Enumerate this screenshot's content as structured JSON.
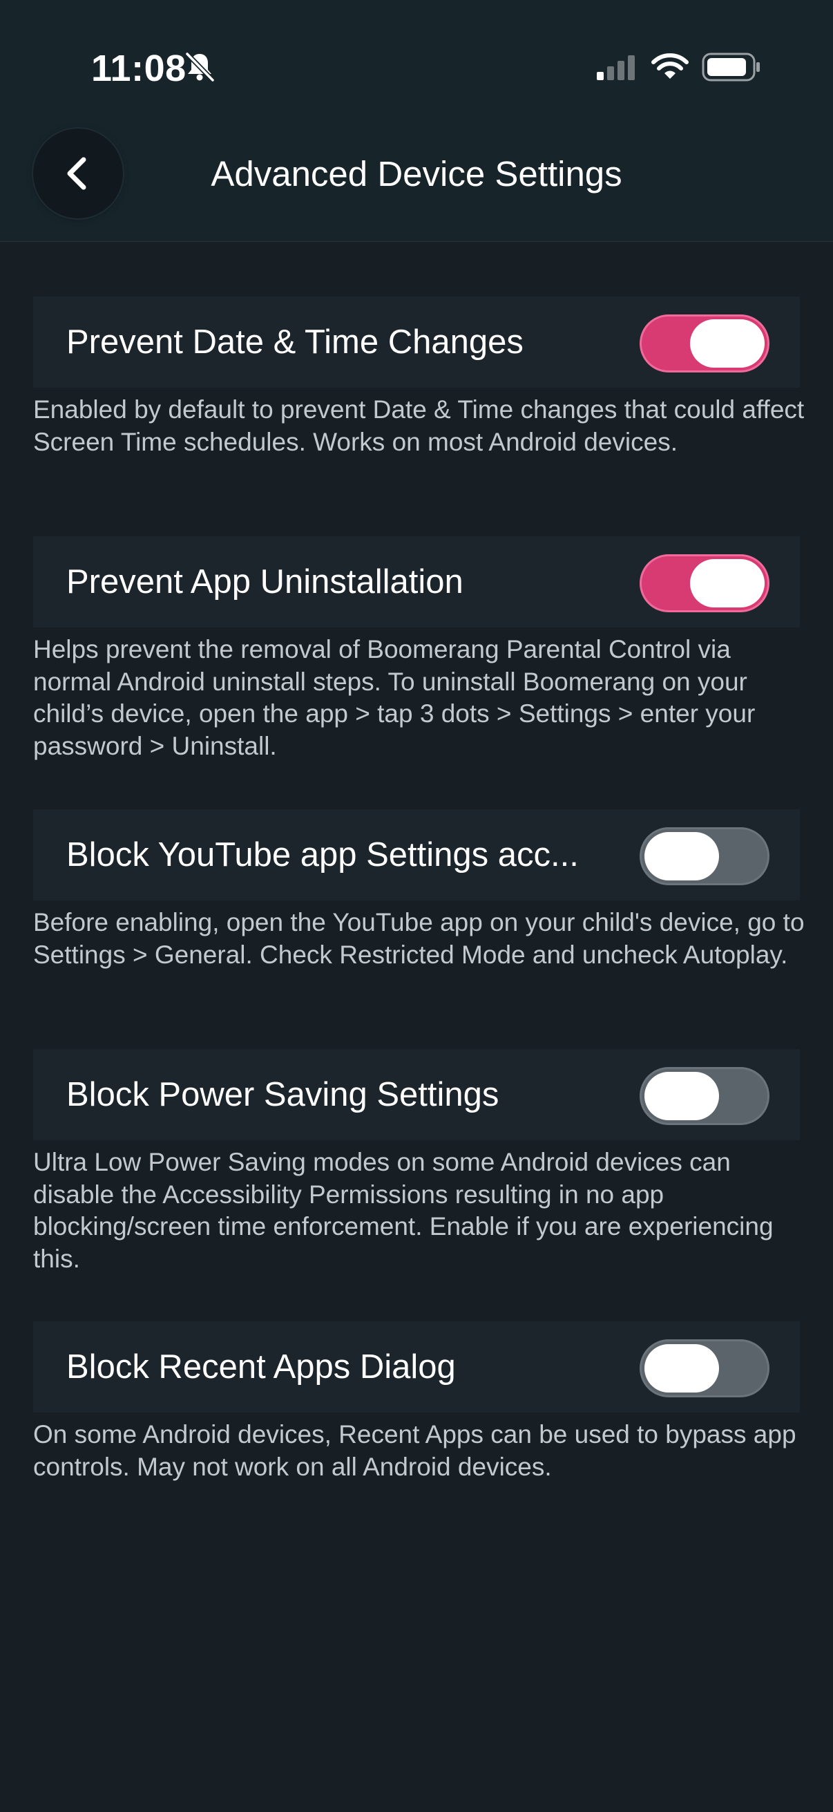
{
  "status_bar": {
    "time": "11:08",
    "icons": [
      "bell-slash-icon",
      "cellular-signal-icon",
      "wifi-icon",
      "battery-icon"
    ]
  },
  "header": {
    "back_icon": "chevron-left-icon",
    "title": "Advanced Device Settings"
  },
  "colors": {
    "background": "#171e24",
    "header_background": "#17252b",
    "row_background": "#1c252b",
    "toggle_on": "#d83a72",
    "toggle_off": "#5b646b",
    "description_text": "#c4c9cd"
  },
  "settings": [
    {
      "label": "Prevent Date & Time Changes",
      "enabled": true,
      "description": "Enabled by default to prevent Date & Time changes that could affect Screen Time schedules. Works on most Android devices."
    },
    {
      "label": "Prevent App Uninstallation",
      "enabled": true,
      "description": "Helps prevent the removal of Boomerang Parental Control via normal Android uninstall steps. To uninstall Boomerang on your child’s device, open the app > tap 3 dots > Settings > enter your password > Uninstall."
    },
    {
      "label": "Block YouTube app Settings acc...",
      "enabled": false,
      "description": "Before enabling, open the YouTube app on your child's device, go to Settings > General. Check Restricted Mode and uncheck Autoplay."
    },
    {
      "label": "Block Power Saving Settings",
      "enabled": false,
      "description": "Ultra Low Power Saving modes on some Android devices can disable the Accessibility Permissions resulting in no app blocking/screen time enforcement. Enable if you are experiencing this."
    },
    {
      "label": "Block Recent Apps Dialog",
      "enabled": false,
      "description": "On some Android devices, Recent Apps can be used to bypass app controls. May not work on all Android devices."
    }
  ]
}
